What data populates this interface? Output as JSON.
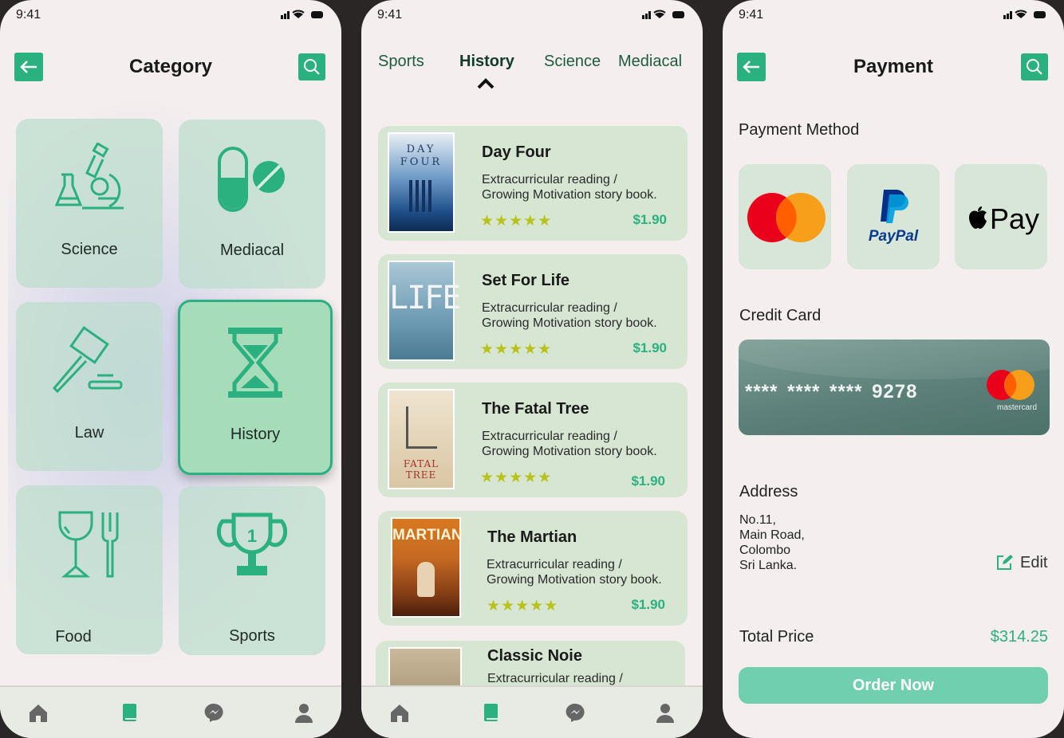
{
  "status": {
    "time": "9:41"
  },
  "category_screen": {
    "title": "Category",
    "tiles": [
      {
        "label": "Science",
        "icon": "science-icon"
      },
      {
        "label": "Mediacal",
        "icon": "medical-icon"
      },
      {
        "label": "Law",
        "icon": "gavel-icon"
      },
      {
        "label": "History",
        "icon": "hourglass-icon",
        "selected": true
      },
      {
        "label": "Food",
        "icon": "food-icon"
      },
      {
        "label": "Sports",
        "icon": "trophy-icon"
      }
    ]
  },
  "books_screen": {
    "tabs": [
      "Sports",
      "History",
      "Science",
      "Mediacal"
    ],
    "active_tab": "History",
    "books": [
      {
        "title": "Day Four",
        "desc1": "Extracurricular reading /",
        "desc2": "Growing Motivation story book.",
        "stars": "★★★★★",
        "price": "$1.90",
        "cover_text": "DAY FOUR"
      },
      {
        "title": "Set For Life",
        "desc1": "Extracurricular reading /",
        "desc2": "Growing Motivation story book.",
        "stars": "★★★★★",
        "price": "$1.90",
        "cover_text": "LIFE"
      },
      {
        "title": "The Fatal Tree",
        "desc1": "Extracurricular reading /",
        "desc2": "Growing Motivation story book.",
        "stars": "★★★★★",
        "price": "$1.90",
        "cover_text": "FATAL TREE"
      },
      {
        "title": "The Martian",
        "desc1": "Extracurricular reading /",
        "desc2": "Growing Motivation story book.",
        "stars": "★★★★★",
        "price": "$1.90",
        "cover_text": "MARTIAN"
      },
      {
        "title": "Classic Noie",
        "desc1": "Extracurricular reading /",
        "desc2": "",
        "stars": "",
        "price": "",
        "cover_text": ""
      }
    ]
  },
  "payment_screen": {
    "title": "Payment",
    "payment_method_label": "Payment Method",
    "methods": [
      "mastercard",
      "PayPal",
      "Pay"
    ],
    "credit_card_label": "Credit Card",
    "card_number": "**** **** **** 9278",
    "card_brand": "mastercard",
    "address_label": "Address",
    "address_lines": [
      "No.11,",
      "Main Road,",
      "Colombo",
      "Sri Lanka."
    ],
    "edit_label": "Edit",
    "total_label": "Total Price",
    "total_value": "$314.25",
    "order_button": "Order Now"
  },
  "colors": {
    "accent": "#2bb07f",
    "tile": "#bedecd",
    "star": "#b9c21a",
    "order_button": "#6fcfae"
  }
}
